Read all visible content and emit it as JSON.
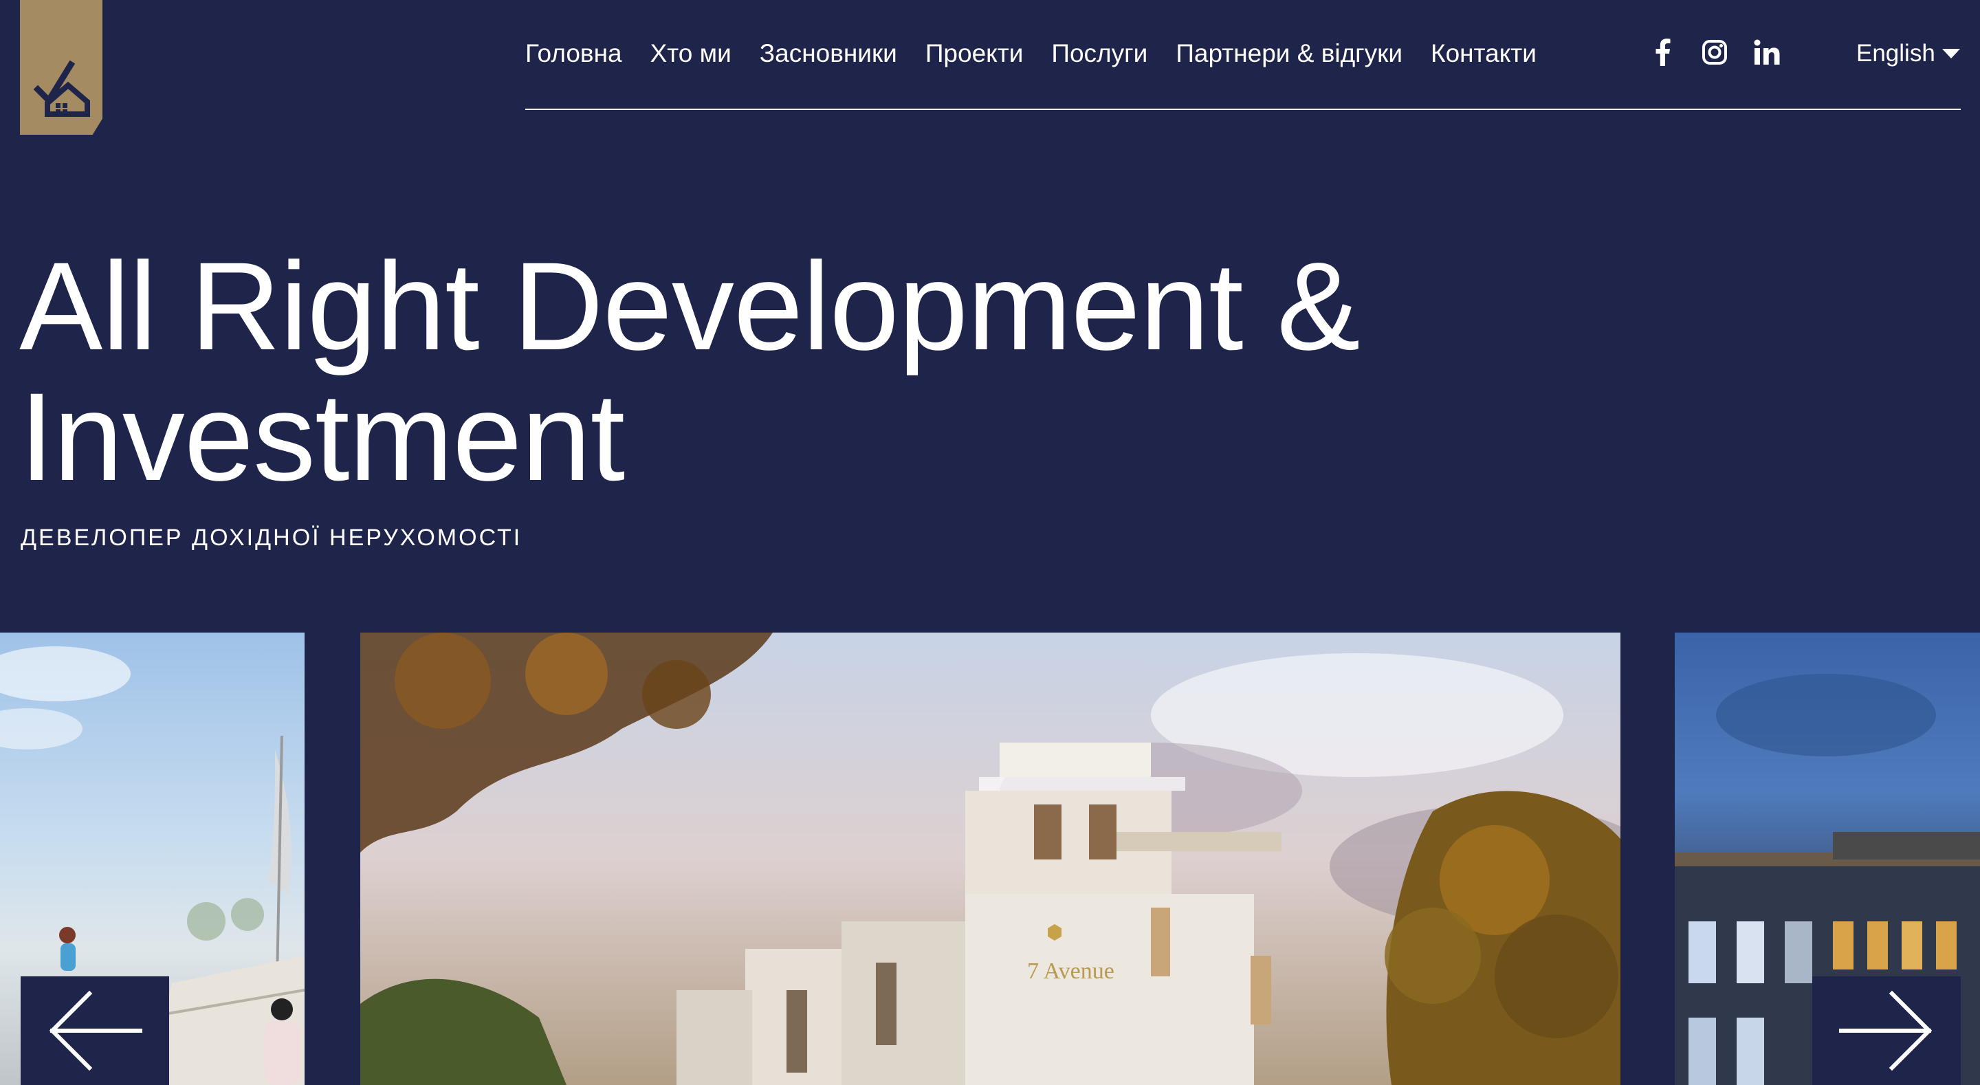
{
  "logo": {
    "icon": "house-checkmark-logo-icon",
    "color": "#a48b62"
  },
  "nav": {
    "items": [
      {
        "label": "Головна"
      },
      {
        "label": "Хто ми"
      },
      {
        "label": "Засновники"
      },
      {
        "label": "Проекти"
      },
      {
        "label": "Послуги"
      },
      {
        "label": "Партнери & відгуки"
      },
      {
        "label": "Контакти"
      }
    ]
  },
  "socials": [
    {
      "icon": "facebook-icon"
    },
    {
      "icon": "instagram-icon"
    },
    {
      "icon": "linkedin-icon"
    }
  ],
  "language": {
    "selected": "English",
    "icon": "caret-down-icon"
  },
  "hero": {
    "title": "All Right Development & Investment",
    "subtitle": "ДЕВЕЛОПЕР ДОХІДНОЇ НЕРУХОМОСТІ"
  },
  "carousel": {
    "main_slide_sign": "7 Avenue",
    "prev_icon": "arrow-left-icon",
    "next_icon": "arrow-right-icon"
  },
  "colors": {
    "background": "#1f254a",
    "accent": "#a48b62",
    "text": "#ffffff"
  }
}
